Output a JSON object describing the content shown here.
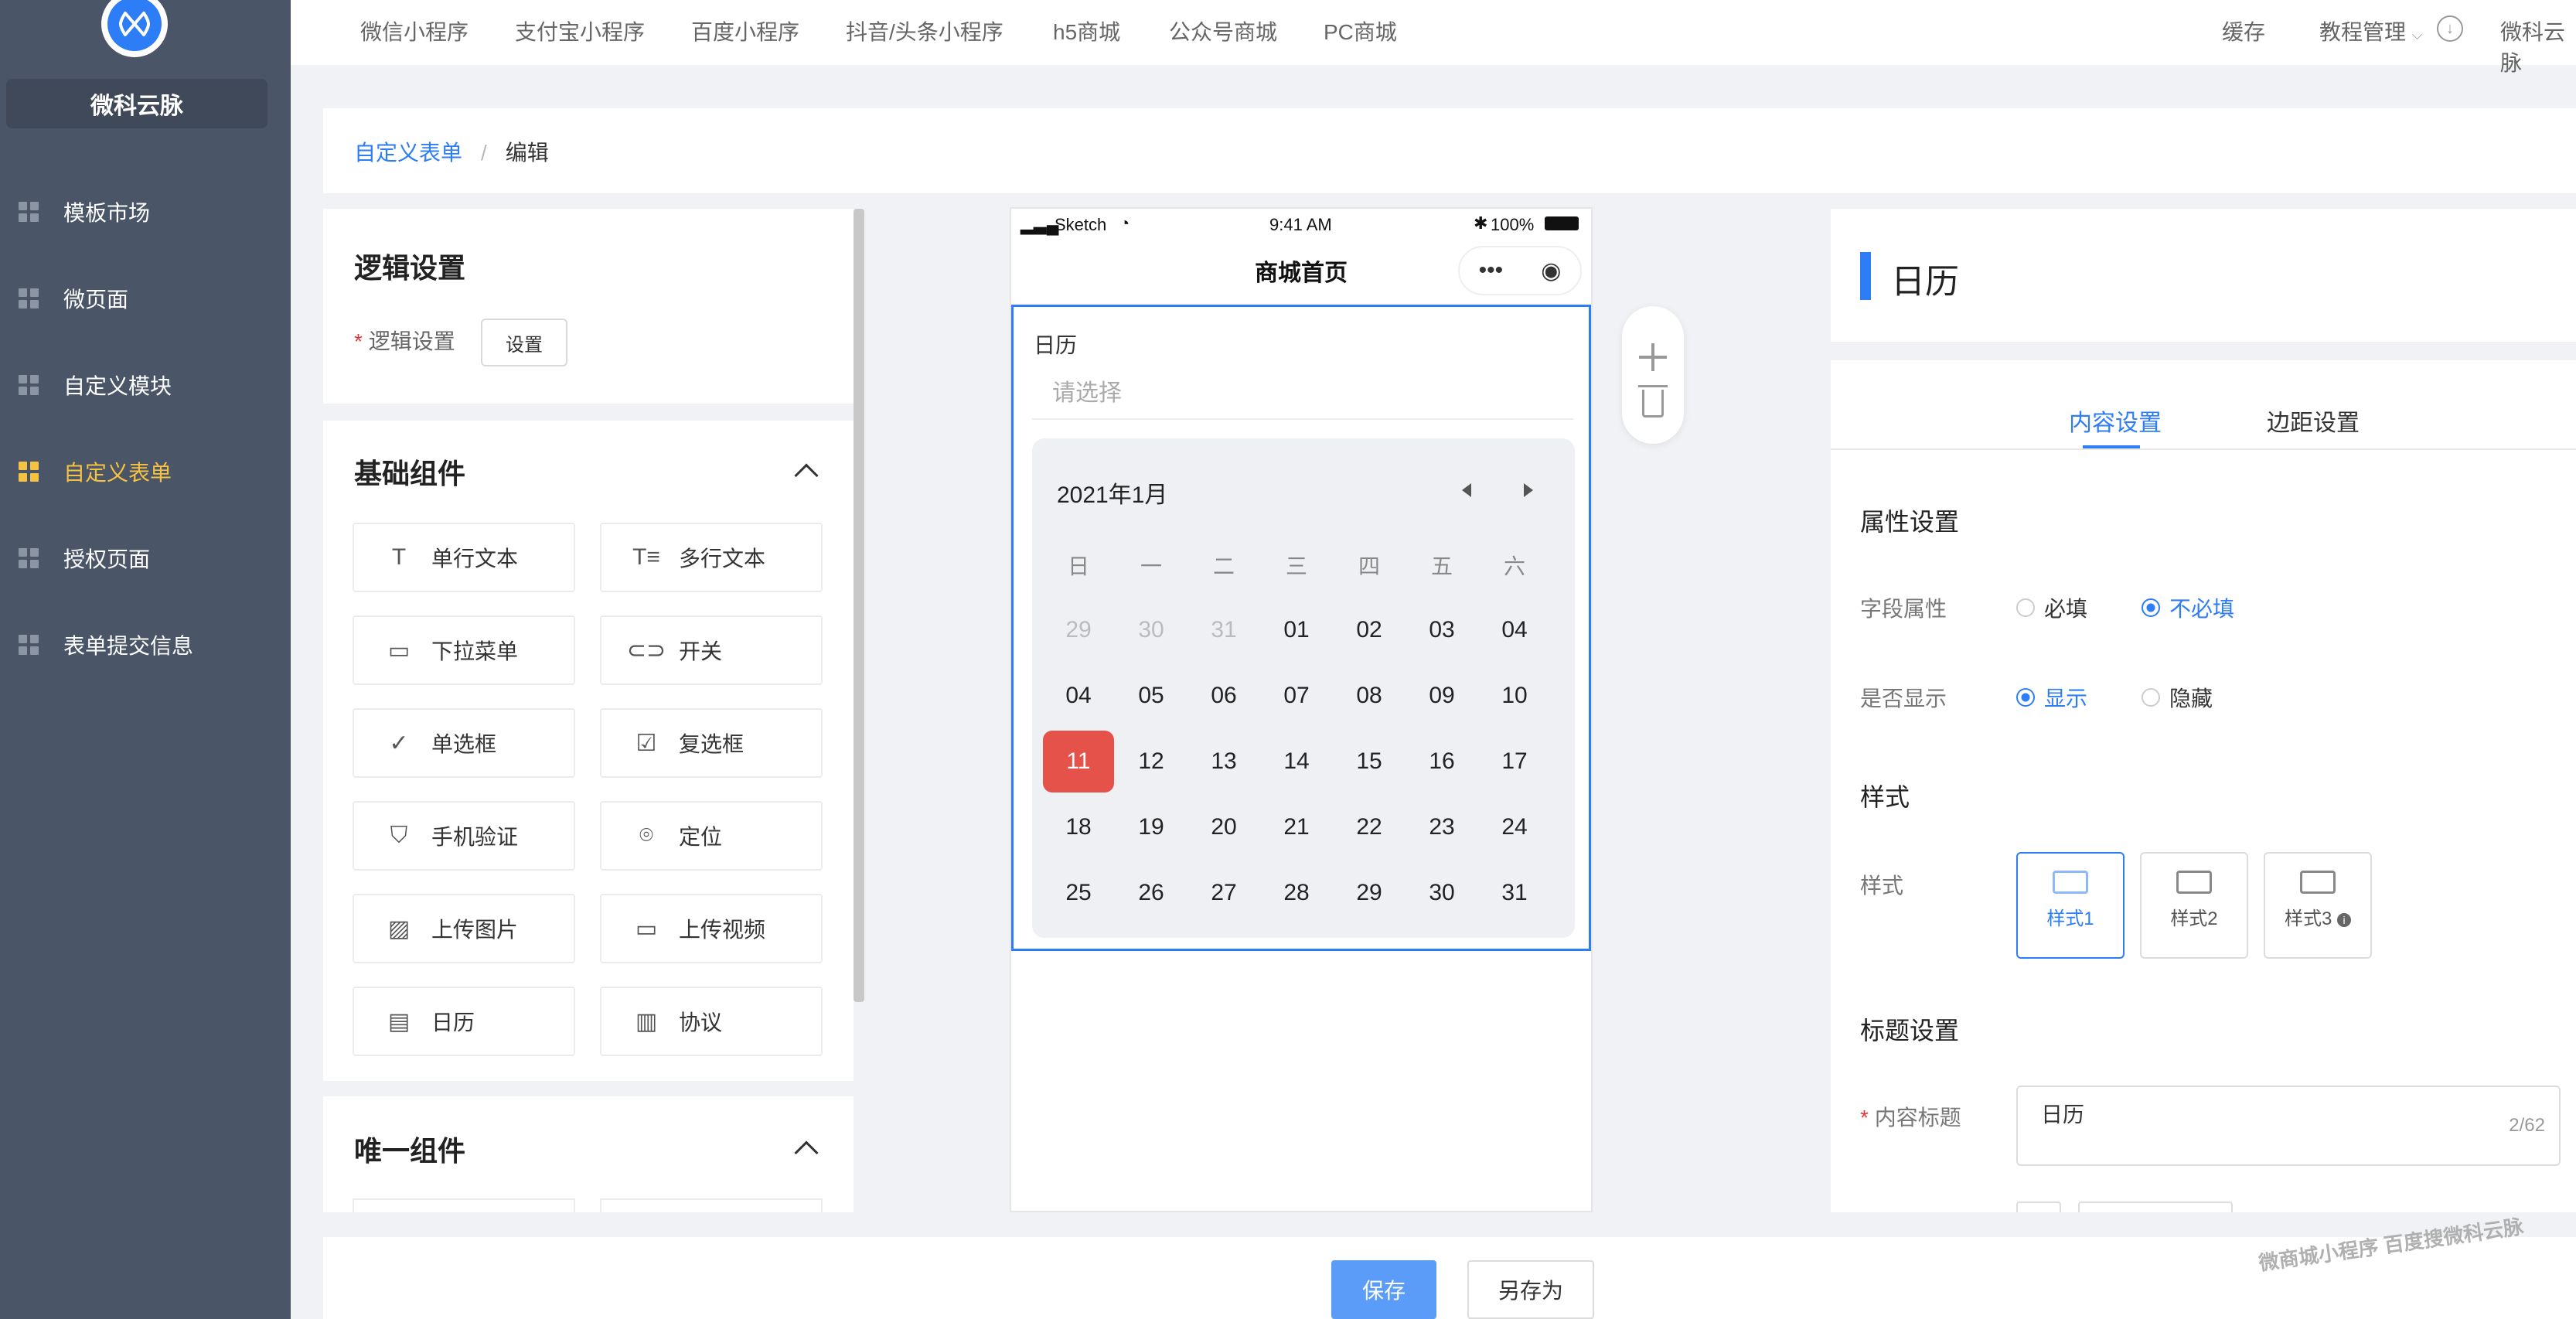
{
  "brand": {
    "name": "微科云脉"
  },
  "sidebar": {
    "items": [
      {
        "label": "模板市场",
        "active": false
      },
      {
        "label": "微页面",
        "active": false
      },
      {
        "label": "自定义模块",
        "active": false
      },
      {
        "label": "自定义表单",
        "active": true
      },
      {
        "label": "授权页面",
        "active": false
      },
      {
        "label": "表单提交信息",
        "active": false
      }
    ]
  },
  "topbar": {
    "tabs": [
      "微信小程序",
      "支付宝小程序",
      "百度小程序",
      "抖音/头条小程序",
      "h5商城",
      "公众号商城",
      "PC商城"
    ],
    "cache": "缓存",
    "tutorial": "教程管理",
    "user": "微科云脉"
  },
  "breadcrumb": {
    "root": "自定义表单",
    "sep": "/",
    "current": "编辑"
  },
  "left_panel": {
    "logic_title": "逻辑设置",
    "logic_label": "逻辑设置",
    "logic_button": "设置",
    "basic_title": "基础组件",
    "components": [
      "单行文本",
      "多行文本",
      "下拉菜单",
      "开关",
      "单选框",
      "复选框",
      "手机验证",
      "定位",
      "上传图片",
      "上传视频",
      "日历",
      "协议"
    ],
    "unique_title": "唯一组件"
  },
  "phone": {
    "carrier": "Sketch",
    "time": "9:41 AM",
    "battery": "100%",
    "title": "商城首页",
    "field_label": "日历",
    "placeholder": "请选择",
    "calendar": {
      "month": "2021年1月",
      "weekdays": [
        "日",
        "一",
        "二",
        "三",
        "四",
        "五",
        "六"
      ],
      "rows": [
        [
          "29",
          "30",
          "31",
          "01",
          "02",
          "03",
          "04"
        ],
        [
          "04",
          "05",
          "06",
          "07",
          "08",
          "09",
          "10"
        ],
        [
          "11",
          "12",
          "13",
          "14",
          "15",
          "16",
          "17"
        ],
        [
          "18",
          "19",
          "20",
          "21",
          "22",
          "23",
          "24"
        ],
        [
          "25",
          "26",
          "27",
          "28",
          "29",
          "30",
          "31"
        ]
      ],
      "selected": "11"
    }
  },
  "right_panel": {
    "title": "日历",
    "tabs": [
      "内容设置",
      "边距设置"
    ],
    "attr_title": "属性设置",
    "field_attr": {
      "label": "字段属性",
      "options": [
        "必填",
        "不必填"
      ],
      "selected": "不必填"
    },
    "show": {
      "label": "是否显示",
      "options": [
        "显示",
        "隐藏"
      ],
      "selected": "显示"
    },
    "style_title": "样式",
    "style_label": "样式",
    "styles": [
      "样式1",
      "样式2",
      "样式3"
    ],
    "selected_style": "样式1",
    "title_settings": "标题设置",
    "content_title_label": "内容标题",
    "content_title_value": "日历",
    "content_title_count": "2/62"
  },
  "footer": {
    "save": "保存",
    "save_as": "另存为"
  },
  "watermark": "微商城小程序  百度搜微科云脉",
  "colors": {
    "accent": "#2d7df6",
    "sidebar": "#4a5567",
    "active_nav": "#f5c242",
    "selected_day": "#e5524a"
  }
}
